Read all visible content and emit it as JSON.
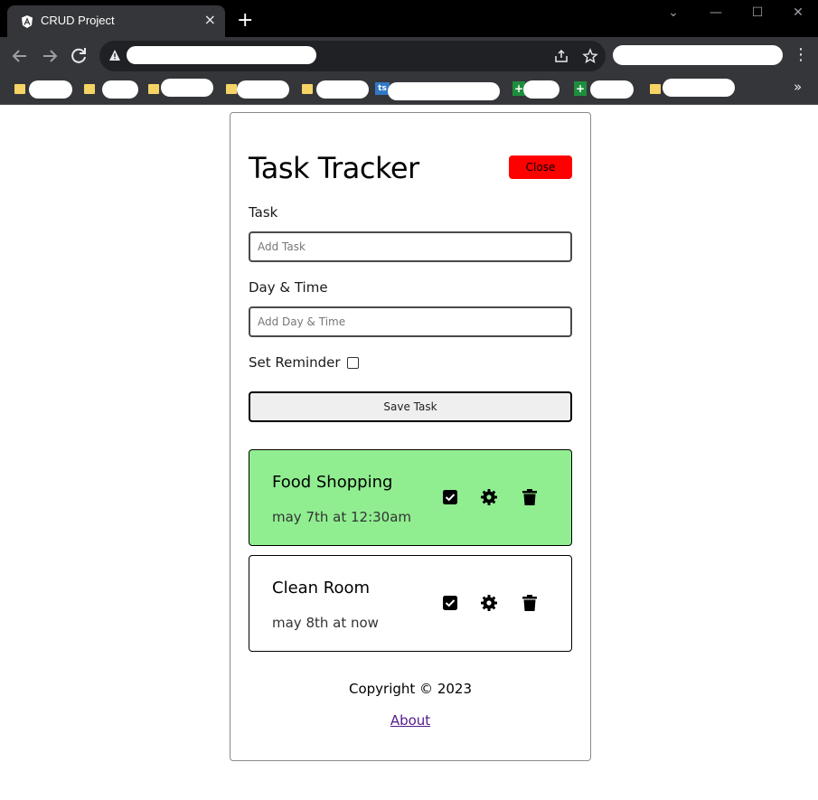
{
  "browser": {
    "tab_title": "CRUD Project",
    "tab_close": "×",
    "new_tab": "+",
    "window_controls": [
      "⌄",
      "—",
      "☐",
      "✕"
    ],
    "menu_glyph": "⋮",
    "bookmarks_more": "»",
    "bookmark_ts_badge": "ts",
    "bookmark_sheet_badge": "+"
  },
  "app": {
    "title": "Task Tracker",
    "close_label": "Close",
    "close_color": "#ff0000"
  },
  "form": {
    "task_label": "Task",
    "task_placeholder": "Add Task",
    "day_label": "Day & Time",
    "day_placeholder": "Add Day & Time",
    "reminder_label": "Set Reminder",
    "reminder_checked": false,
    "save_label": "Save Task"
  },
  "tasks": [
    {
      "text": "Food Shopping",
      "day": "may 7th at 12:30am",
      "reminder": true,
      "background": "#90ee90"
    },
    {
      "text": "Clean Room",
      "day": "may 8th at now",
      "reminder": false,
      "background": "#ffffff"
    }
  ],
  "footer": {
    "copyright": "Copyright © 2023",
    "about_label": "About"
  }
}
